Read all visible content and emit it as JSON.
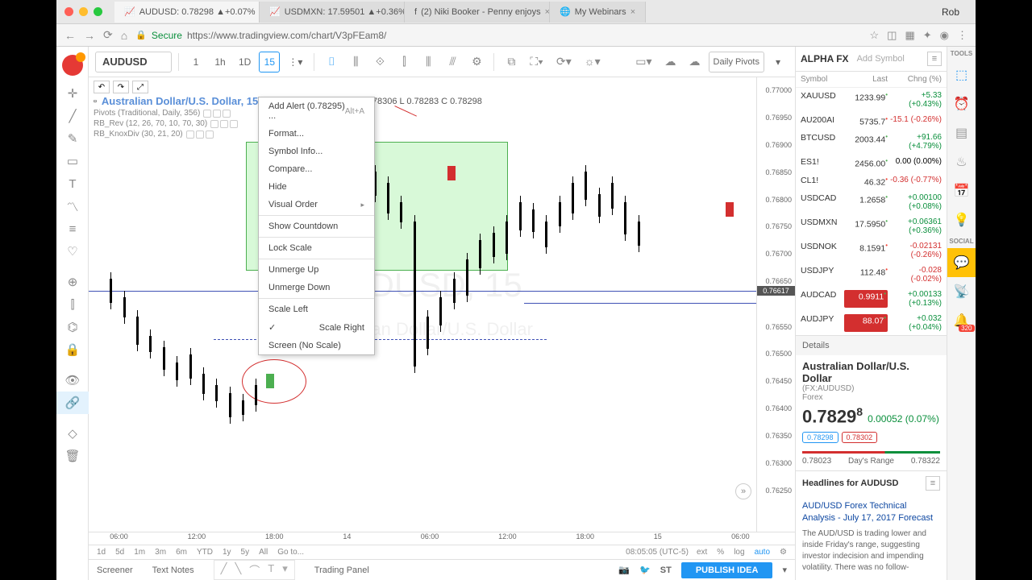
{
  "browser": {
    "user": "Rob",
    "tabs": [
      {
        "title": "AUDUSD: 0.78298 ▲+0.07%",
        "active": true
      },
      {
        "title": "USDMXN: 17.59501 ▲+0.36%",
        "active": false
      },
      {
        "title": "(2) Niki Booker - Penny enjoys",
        "active": false
      },
      {
        "title": "My Webinars",
        "active": false
      }
    ],
    "secure": "Secure",
    "url": "https://www.tradingview.com/chart/V3pFEam8/"
  },
  "toolbar": {
    "symbol": "AUDUSD",
    "intervals": [
      "1",
      "1h",
      "1D",
      "15"
    ],
    "active_interval": "15",
    "daily_pivots": "Daily Pivots"
  },
  "chart": {
    "title": "Australian Dollar/U.S. Dollar, 15, FXCM",
    "ohlc": "O 0.78289 H 0.78306 L 0.78283 C 0.78298",
    "indicators": [
      "Pivots (Traditional, Daily, 356)",
      "RB_Rev (12, 26, 70, 10, 70, 30)",
      "RB_KnoxDiv (30, 21, 20)"
    ],
    "watermark": "AUDUSD, 15\nAustralian Dollar/U.S. Dollar",
    "price_ticks": [
      "0.77000",
      "0.76950",
      "0.76900",
      "0.76850",
      "0.76800",
      "0.76750",
      "0.76700",
      "0.76650",
      "0.76617",
      "0.76550",
      "0.76500",
      "0.76450",
      "0.76400",
      "0.76350",
      "0.76300",
      "0.76250"
    ],
    "current_price": "0.76617",
    "time_ticks": [
      "06:00",
      "12:00",
      "18:00",
      "14",
      "06:00",
      "12:00",
      "18:00",
      "15",
      "06:00"
    ]
  },
  "context_menu": {
    "items": [
      {
        "label": "Add Alert (0.78295) ...",
        "shortcut": "Alt+A"
      },
      {
        "label": "Format..."
      },
      {
        "label": "Symbol Info..."
      },
      {
        "label": "Compare..."
      },
      {
        "label": "Hide"
      },
      {
        "label": "Visual Order",
        "submenu": true
      },
      {
        "sep": true
      },
      {
        "label": "Show Countdown"
      },
      {
        "sep": true
      },
      {
        "label": "Lock Scale"
      },
      {
        "sep": true
      },
      {
        "label": "Unmerge Up"
      },
      {
        "label": "Unmerge Down"
      },
      {
        "sep": true
      },
      {
        "label": "Scale Left"
      },
      {
        "label": "Scale Right",
        "checked": true
      },
      {
        "label": "Screen (No Scale)"
      }
    ]
  },
  "timeframes": {
    "items": [
      "1d",
      "5d",
      "1m",
      "3m",
      "6m",
      "YTD",
      "1y",
      "5y",
      "All"
    ],
    "goto": "Go to...",
    "clock": "08:05:05 (UTC-5)",
    "ext": "ext",
    "pct": "%",
    "log": "log",
    "auto": "auto"
  },
  "bottom": {
    "tabs": [
      "Screener",
      "Text Notes",
      "",
      "Trading Panel"
    ],
    "st": "ST",
    "publish": "PUBLISH IDEA"
  },
  "watchlist": {
    "tab": "ALPHA FX",
    "add_placeholder": "Add Symbol",
    "cols": [
      "Symbol",
      "Last",
      "Chng (%)"
    ],
    "rows": [
      {
        "sym": "XAUUSD",
        "last": "1233.99",
        "chg": "+5.33 (+0.43%)",
        "dir": "up"
      },
      {
        "sym": "AU200AI",
        "last": "5735.7",
        "chg": "-15.1 (-0.26%)",
        "dir": "dn"
      },
      {
        "sym": "BTCUSD",
        "last": "2003.44",
        "chg": "+91.66 (+4.79%)",
        "dir": "up"
      },
      {
        "sym": "ES1!",
        "last": "2456.00",
        "chg": "0.00 (0.00%)",
        "dir": ""
      },
      {
        "sym": "CL1!",
        "last": "46.32",
        "chg": "-0.36 (-0.77%)",
        "dir": "dn"
      },
      {
        "sym": "USDCAD",
        "last": "1.2658",
        "chg": "+0.00100 (+0.08%)",
        "dir": "up"
      },
      {
        "sym": "USDMXN",
        "last": "17.5950",
        "chg": "+0.06361 (+0.36%)",
        "dir": "up"
      },
      {
        "sym": "USDNOK",
        "last": "8.1591",
        "chg": "-0.02131 (-0.26%)",
        "dir": "dn"
      },
      {
        "sym": "USDJPY",
        "last": "112.48",
        "chg": "-0.028 (-0.02%)",
        "dir": "dn"
      },
      {
        "sym": "AUDCAD",
        "last": "0.9911",
        "chg": "+0.00133 (+0.13%)",
        "dir": "up",
        "badge": "red"
      },
      {
        "sym": "AUDJPY",
        "last": "88.07",
        "chg": "+0.032 (+0.04%)",
        "dir": "up",
        "badge": "red"
      }
    ],
    "details_label": "Details"
  },
  "details": {
    "name": "Australian Dollar/U.S. Dollar",
    "symbol": "(FX:AUDUSD)",
    "type": "Forex",
    "price": "0.7829",
    "price_sup": "8",
    "change": "0.00052 (0.07%)",
    "pill_low": "0.78298",
    "pill_high": "0.78302",
    "range_low": "0.78023",
    "range_label": "Day's Range",
    "range_high": "0.78322"
  },
  "headlines": {
    "title": "Headlines for AUDUSD",
    "item_title": "AUD/USD Forex Technical Analysis - July 17, 2017 Forecast",
    "item_body": "The AUD/USD is trading lower and inside Friday's range, suggesting investor indecision and impending volatility. There was no follow-"
  },
  "far_rail": {
    "tools": "TOOLS",
    "social": "SOCIAL",
    "badge_count": "320"
  }
}
